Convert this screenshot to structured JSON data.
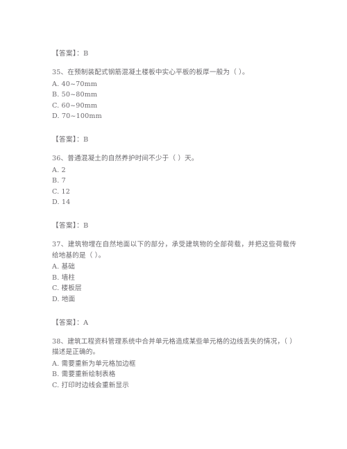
{
  "document": {
    "type": "exam-question-sheet",
    "language": "zh-CN",
    "text_color": "#6a686c",
    "background_color": "#ffffff",
    "blocks": [
      {
        "kind": "answer",
        "label": "【答案】：",
        "value": "B"
      },
      {
        "kind": "question",
        "number": "35",
        "stem": "35、在预制装配式钢筋混凝土楼板中实心平板的板厚一般为（    ）。",
        "options": [
          "A. 40~70mm",
          "B. 50~80mm",
          "C. 60~90mm",
          "D. 70~100mm"
        ]
      },
      {
        "kind": "answer",
        "label": "【答案】：",
        "value": "B"
      },
      {
        "kind": "question",
        "number": "36",
        "stem": "36、普通混凝土的自然养护时间不少于（    ）天。",
        "options": [
          "A. 2",
          "B. 7",
          "C. 12",
          "D. 14"
        ]
      },
      {
        "kind": "answer",
        "label": "【答案】：",
        "value": "B"
      },
      {
        "kind": "question",
        "number": "37",
        "stem": "37、建筑物埋在自然地面以下的部分，承受建筑物的全部荷载，并把这些荷载传给地基的是（    ）。",
        "options": [
          "A. 基础",
          "B. 墙柱",
          "C. 楼板层",
          "D. 地面"
        ]
      },
      {
        "kind": "answer",
        "label": "【答案】：",
        "value": "A"
      },
      {
        "kind": "question",
        "number": "38",
        "stem": "38、建筑工程资料管理系统中合并单元格造成某些单元格的边线丢失的情况，（    ）描述是正确的。",
        "options": [
          "A. 需要重新为单元格加边框",
          "B. 需要重新绘制表格",
          "C. 打印时边线会重新显示"
        ]
      }
    ]
  }
}
